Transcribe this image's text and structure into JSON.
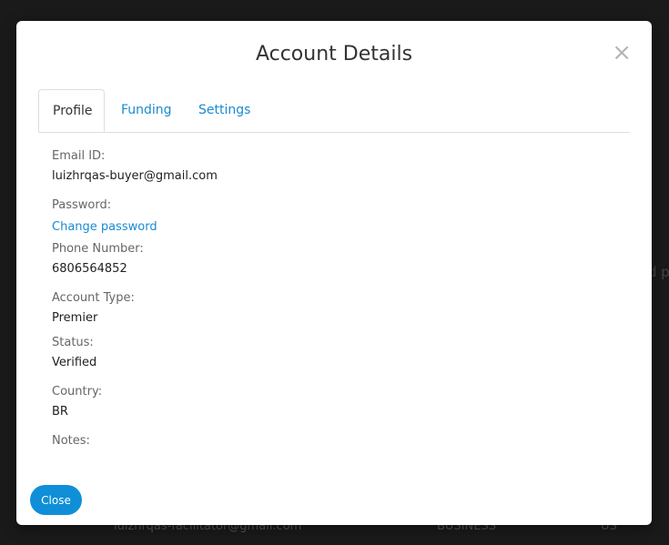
{
  "background": {
    "row_email": "luizhrqas-facilitator@gmail.com",
    "row_type": "BUSINESS",
    "row_country": "US",
    "right_fragment": "d p"
  },
  "modal": {
    "title": "Account Details",
    "close_symbol": "×",
    "tabs": [
      {
        "label": "Profile",
        "active": true
      },
      {
        "label": "Funding",
        "active": false
      },
      {
        "label": "Settings",
        "active": false
      }
    ],
    "fields": {
      "email_label": "Email ID:",
      "email_value": "luizhrqas-buyer@gmail.com",
      "password_label": "Password:",
      "password_link": "Change password",
      "phone_label": "Phone Number:",
      "phone_value": "6806564852",
      "account_type_label": "Account Type:",
      "account_type_value": "Premier",
      "status_label": "Status:",
      "status_value": "Verified",
      "country_label": "Country:",
      "country_value": "BR",
      "notes_label": "Notes:",
      "notes_value": ""
    },
    "close_button": "Close"
  },
  "colors": {
    "link": "#1a8ad1",
    "primary_button": "#0f8fd8"
  }
}
